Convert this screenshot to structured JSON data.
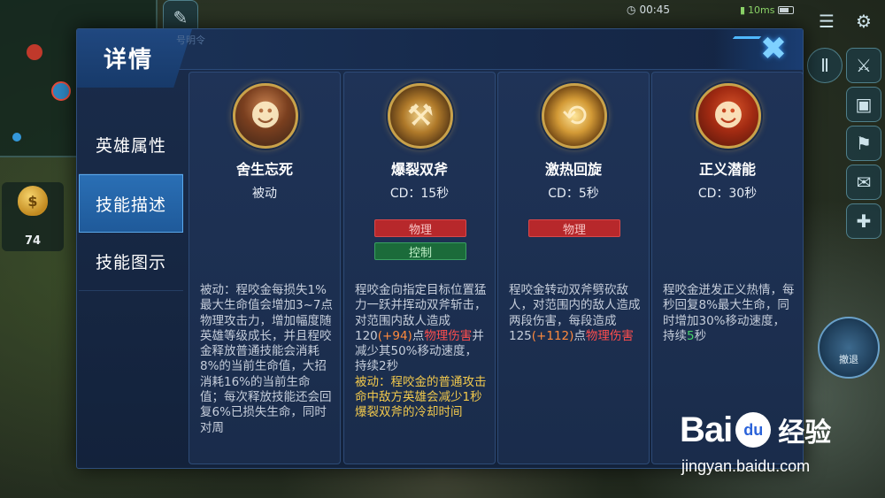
{
  "dialog": {
    "title": "详情",
    "header_ghost_text": "号明令",
    "close_label": "✖"
  },
  "side_nav": {
    "items": [
      {
        "label": "英雄属性",
        "active": false
      },
      {
        "label": "技能描述",
        "active": true
      },
      {
        "label": "技能图示",
        "active": false
      }
    ]
  },
  "skills": [
    {
      "name": "舍生忘死",
      "cd": "被动",
      "icon": "hero-portrait-icon",
      "tags": [],
      "desc": [
        {
          "text": "被动：程咬金每损失1%最大生命值会增加3~7点物理攻击力，增加幅度随英雄等级成长，并且程咬金释放普通技能会消耗8%的当前生命值，大招消耗16%的当前生命值；每次释放技能还会回复6%已损失生命，同时对周",
          "style": ""
        }
      ]
    },
    {
      "name": "爆裂双斧",
      "cd": "CD：15秒",
      "icon": "twin-axe-icon",
      "tags": [
        {
          "label": "物理",
          "color": "red"
        },
        {
          "label": "控制",
          "color": "green"
        }
      ],
      "desc": [
        {
          "text": "程咬金向指定目标位置猛力一跃并挥动双斧斩击，对范围内敌人造成120",
          "style": ""
        },
        {
          "text": "(+94)",
          "style": "orange"
        },
        {
          "text": "点",
          "style": ""
        },
        {
          "text": "物理伤害",
          "style": "red"
        },
        {
          "text": "并减少其50%移动速度，持续2秒",
          "style": ""
        },
        {
          "text": "被动：程咬金的普通攻击命中敌方英雄会减少1秒爆裂双斧的冷却时间",
          "style": "gold"
        }
      ]
    },
    {
      "name": "激热回旋",
      "cd": "CD：5秒",
      "icon": "spin-axe-icon",
      "tags": [
        {
          "label": "物理",
          "color": "red"
        }
      ],
      "desc": [
        {
          "text": "程咬金转动双斧劈砍敌人，对范围内的敌人造成两段伤害，每段造成125",
          "style": ""
        },
        {
          "text": "(+112)",
          "style": "orange"
        },
        {
          "text": "点",
          "style": ""
        },
        {
          "text": "物理伤害",
          "style": "red"
        }
      ]
    },
    {
      "name": "正义潜能",
      "cd": "CD：30秒",
      "icon": "justice-hero-icon",
      "tags": [],
      "desc": [
        {
          "text": "程咬金迸发正义热情，每秒回复8%最大生命，同时增加30%移动速度，持续",
          "style": ""
        },
        {
          "text": "5",
          "style": "green"
        },
        {
          "text": "秒",
          "style": ""
        }
      ]
    }
  ],
  "hud": {
    "time": "00:45",
    "ping": "10ms",
    "gold": "74",
    "gold_icon": "$",
    "right_skill_label": "撤退"
  },
  "watermark": {
    "brand_left": "Bai",
    "brand_paw": "du",
    "brand_right": "经验",
    "url": "jingyan.baidu.com"
  }
}
